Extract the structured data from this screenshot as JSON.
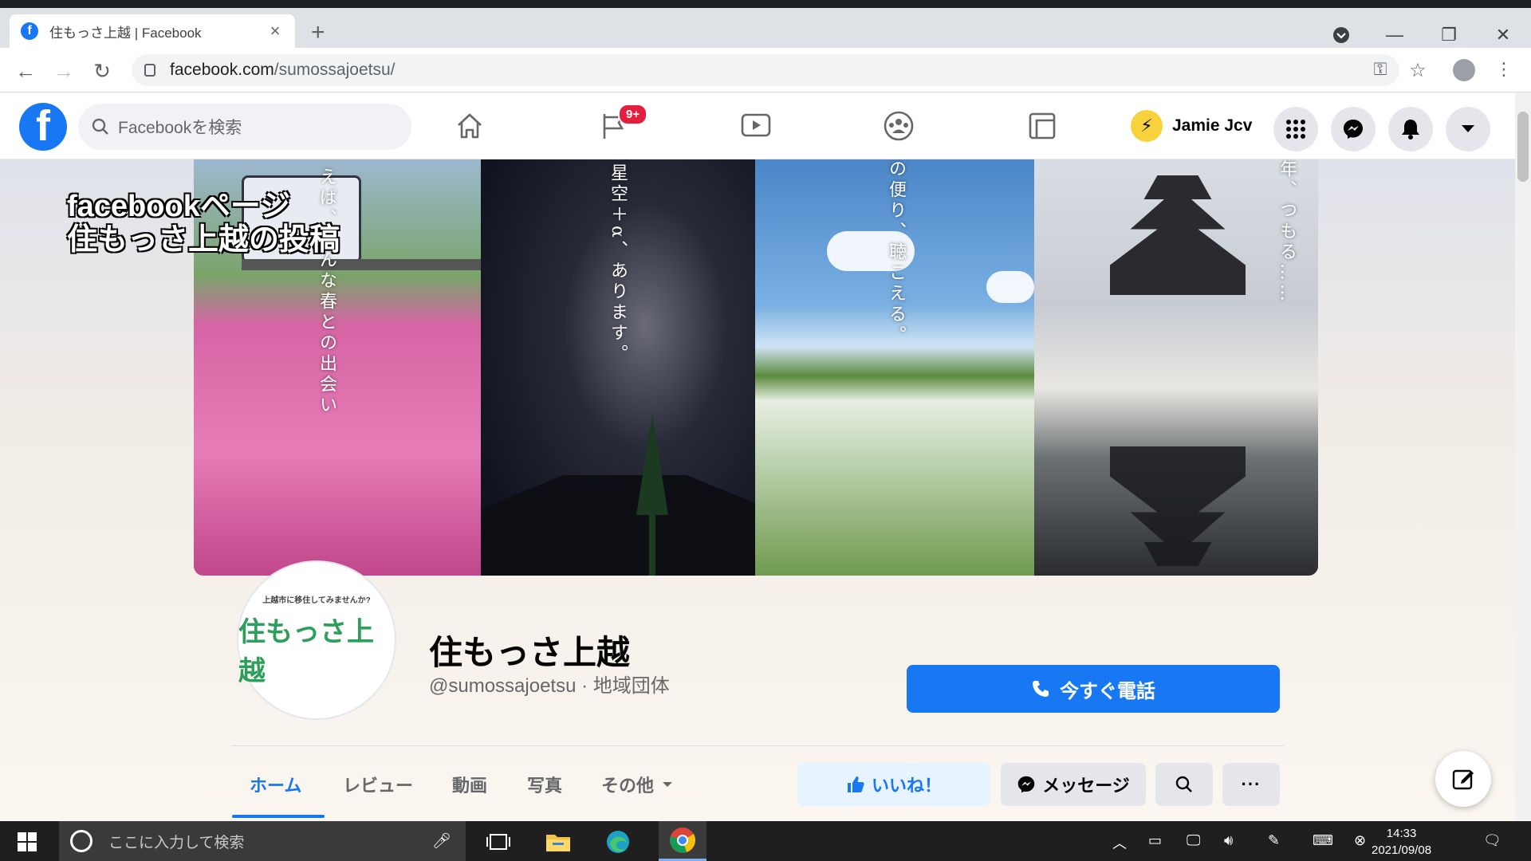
{
  "browser": {
    "tab_title": "住もっさ上越 | Facebook",
    "tab_favicon": "f",
    "new_tab": "+",
    "url_domain": "facebook.com",
    "url_path": "/sumossajoetsu/"
  },
  "facebook": {
    "logo": "f",
    "search_placeholder": "Facebookを検索",
    "notification_badge": "9+",
    "user_name": "Jamie Jcv"
  },
  "cover": {
    "overlay_line1": "facebookページ",
    "overlay_line2": "住もっさ上越の投稿",
    "panel_texts": [
      "えば、こんな春との出会い",
      "星空＋α、あります。",
      "の便り、聴こえる。",
      "年、つもる……"
    ]
  },
  "profile": {
    "logo_small": "上越市に移住してみませんか?",
    "logo_big": "住もっさ上越",
    "page_name": "住もっさ上越",
    "page_sub": "@sumossajoetsu · 地域団体",
    "call_button": "今すぐ電話"
  },
  "page_tabs": [
    "ホーム",
    "レビュー",
    "動画",
    "写真",
    "その他"
  ],
  "actions": {
    "like": "いいね！",
    "message": "メッセージ",
    "more": "···"
  },
  "taskbar": {
    "search_placeholder": "ここに入力して検索",
    "time": "14:33",
    "date": "2021/09/08"
  },
  "colors": {
    "fb_blue": "#1877f2",
    "badge_red": "#e41e3f"
  }
}
